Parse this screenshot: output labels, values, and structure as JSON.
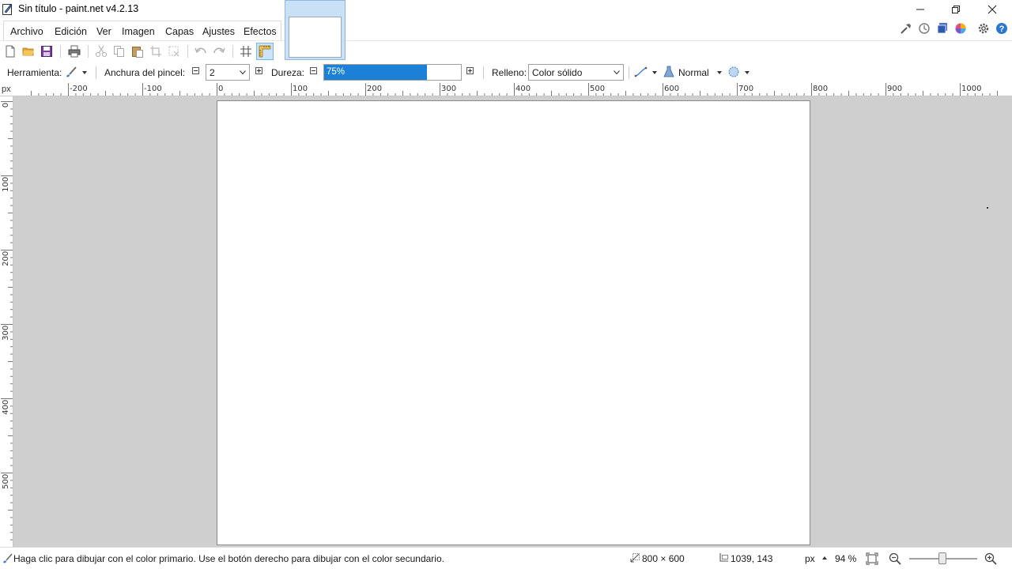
{
  "window": {
    "title": "Sin título - paint.net v4.2.13"
  },
  "menu": {
    "items": [
      "Archivo",
      "Edición",
      "Ver",
      "Imagen",
      "Capas",
      "Ajustes",
      "Efectos"
    ]
  },
  "tool_options": {
    "tool_label": "Herramienta:",
    "brush_width_label": "Anchura del pincel:",
    "brush_width_value": "2",
    "hardness_label": "Dureza:",
    "hardness_value": "75%",
    "hardness_fraction": 0.75,
    "fill_label": "Relleno:",
    "fill_value": "Color sólido",
    "blend_mode": "Normal"
  },
  "rulers": {
    "unit": "px",
    "h_ticks": [
      "-200",
      "-100",
      "0",
      "100",
      "200",
      "300",
      "400",
      "500",
      "600",
      "700",
      "800",
      "900",
      "1000"
    ],
    "v_ticks": [
      "0",
      "100",
      "200",
      "300",
      "400",
      "500"
    ]
  },
  "status": {
    "hint": "Haga clic para dibujar con el color primario. Use el botón derecho para dibujar con el color secundario.",
    "image_size": "800 × 600",
    "cursor_position": "1039, 143",
    "unit": "px",
    "zoom": "94 %"
  },
  "colors": {
    "accent": "#1b80d6",
    "workspace": "#cfcfcf",
    "active_tab": "#c9e0f7"
  }
}
